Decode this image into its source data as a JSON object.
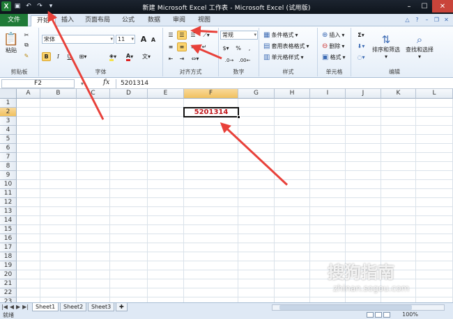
{
  "window": {
    "title": "新建 Microsoft Excel 工作表 - Microsoft Excel (试用版)",
    "app_icon_letter": "X",
    "min_label": "–",
    "max_label": "☐",
    "close_label": "✕"
  },
  "tabs": {
    "file": "文件",
    "items": [
      "开始",
      "插入",
      "页面布局",
      "公式",
      "数据",
      "审阅",
      "视图"
    ],
    "active_index": 0
  },
  "ribbon": {
    "clipboard": {
      "label": "剪贴板",
      "paste": "粘贴"
    },
    "font": {
      "label": "字体",
      "font_name": "宋体",
      "font_size": "11",
      "bold": "B",
      "italic": "I",
      "underline": "U",
      "grow": "A",
      "shrink": "A"
    },
    "alignment": {
      "label": "对齐方式"
    },
    "number": {
      "label": "数字",
      "format": "常规",
      "percent": "%",
      "comma": ",",
      "currency": "$"
    },
    "styles": {
      "label": "样式",
      "conditional": "条件格式",
      "table": "套用表格格式",
      "cell_styles": "单元格样式"
    },
    "cells": {
      "label": "单元格",
      "insert": "插入",
      "delete": "删除",
      "format": "格式"
    },
    "editing": {
      "label": "编辑",
      "sort_filter": "排序和筛选",
      "find_select": "查找和选择",
      "sigma": "Σ"
    }
  },
  "formula_bar": {
    "name_box": "F2",
    "fx": "fx",
    "value": "5201314"
  },
  "grid": {
    "columns": [
      "A",
      "B",
      "C",
      "D",
      "E",
      "F",
      "G",
      "H",
      "I",
      "J",
      "K",
      "L"
    ],
    "rows": [
      "1",
      "2",
      "3",
      "4",
      "5",
      "6",
      "7",
      "8",
      "9",
      "10",
      "11",
      "12",
      "13",
      "14",
      "15",
      "16",
      "17",
      "18",
      "19",
      "20",
      "21",
      "22",
      "23"
    ],
    "active_cell": "F2",
    "active_value": "5201314"
  },
  "sheets": [
    "Sheet1",
    "Sheet2",
    "Sheet3"
  ],
  "status": {
    "ready": "就绪",
    "zoom": "100%"
  },
  "watermark": {
    "text": "搜狗指南",
    "url": "zhinan.sogou.com"
  },
  "colors": {
    "arrow": "#e8413a",
    "active_text": "#c0171c",
    "file_tab": "#1f7a37"
  }
}
